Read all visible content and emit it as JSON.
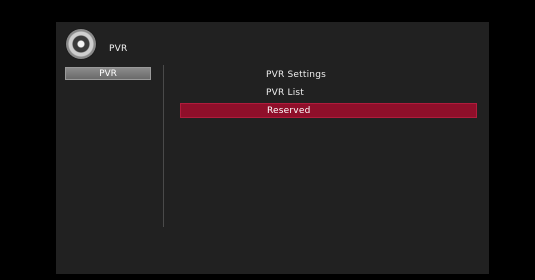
{
  "header": {
    "title": "PVR"
  },
  "left_menu": {
    "items": [
      {
        "label": "PVR",
        "selected": true
      }
    ]
  },
  "main_menu": {
    "items": [
      {
        "label": "PVR Settings",
        "selected": false
      },
      {
        "label": "PVR List",
        "selected": false
      },
      {
        "label": "Reserved",
        "selected": true
      }
    ]
  },
  "colors": {
    "screen_background": "#212121",
    "selected_highlight": "#8f0f2a",
    "tab_background": "#7a7a7a"
  }
}
